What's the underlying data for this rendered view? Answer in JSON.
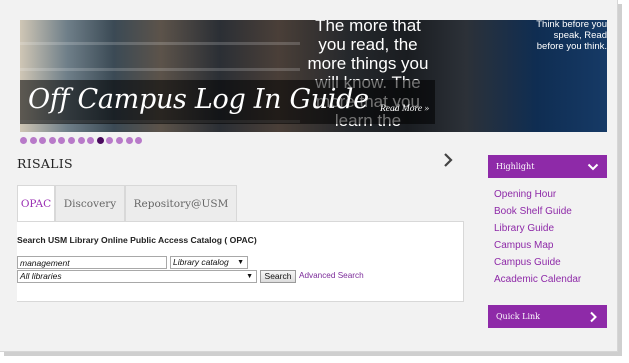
{
  "hero": {
    "title": "Off Campus Log In Guide",
    "read_more": "Read More »",
    "quote_main": "The more that you read, the more things you will know. The more that you learn the",
    "quote_side": "Think before you speak, Read before you think."
  },
  "slider": {
    "dot_count": 13,
    "active_index": 8
  },
  "section": {
    "title": "RISALIS"
  },
  "tabs": [
    {
      "label": "OPAC",
      "active": true
    },
    {
      "label": "Discovery",
      "active": false
    },
    {
      "label": "Repository@USM",
      "active": false
    }
  ],
  "opac": {
    "heading": "Search USM Library Online Public Access Catalog ( OPAC)",
    "search_value": "management",
    "catalog_select": "Library catalog",
    "library_select": "All libraries",
    "search_button": "Search",
    "advanced_link": "Advanced Search"
  },
  "sidebar": {
    "highlight_title": "Highlight",
    "items": [
      "Opening Hour",
      "Book Shelf Guide",
      "Library Guide",
      "Campus Map",
      "Campus Guide",
      "Academic Calendar"
    ],
    "quicklink_title": "Quick Link"
  },
  "colors": {
    "accent": "#8e2aa8",
    "active_dot": "#4a0a5e",
    "dot": "#b87ac9"
  }
}
